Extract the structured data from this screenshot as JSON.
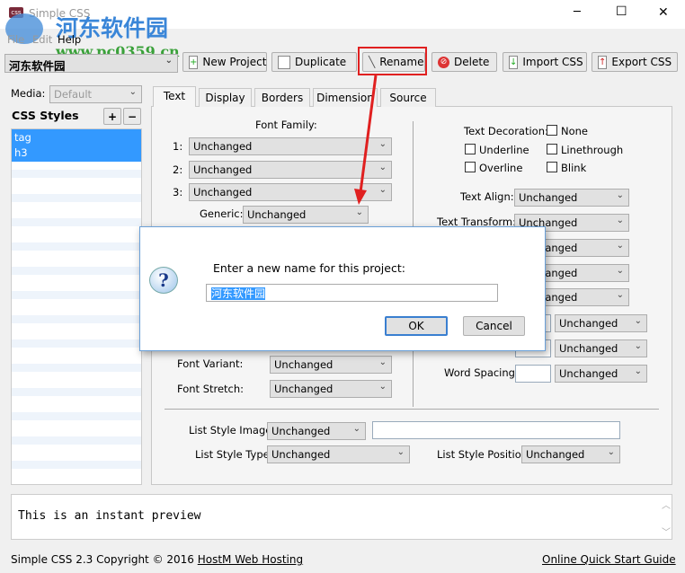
{
  "window": {
    "title": "Simple CSS",
    "minimize": "─",
    "maximize": "☐",
    "close": "✕"
  },
  "watermark": {
    "name": "河东软件园",
    "url": "www.pc0359.cn"
  },
  "menu": [
    "File",
    "Edit",
    "Help"
  ],
  "toolbar": {
    "project": "河东软件园",
    "new_project": "New Project",
    "duplicate": "Duplicate",
    "rename": "Rename",
    "delete": "Delete",
    "import": "Import CSS",
    "export": "Export CSS"
  },
  "sidebar": {
    "media_label": "Media:",
    "media_value": "Default",
    "styles_label": "CSS Styles",
    "add": "+",
    "remove": "−",
    "items": [
      "tag",
      "h3"
    ]
  },
  "tabs": [
    "Text",
    "Display",
    "Borders",
    "Dimension",
    "Source"
  ],
  "text_tab": {
    "font_family": "Font Family:",
    "row_labels": [
      "1:",
      "2:",
      "3:"
    ],
    "generic": "Generic:",
    "unchanged": "Unchanged",
    "font_variant": "Font Variant:",
    "font_stretch": "Font Stretch:",
    "text_decoration": "Text Decoration:",
    "none": "None",
    "underline": "Underline",
    "linethrough": "Linethrough",
    "overline": "Overline",
    "blink": "Blink",
    "text_align": "Text Align:",
    "text_transform": "Text Transform:",
    "word_spacing": "Word Spacing:",
    "list_style_image": "List Style Image:",
    "list_style_type": "List Style Type:",
    "list_style_position": "List Style Position:"
  },
  "preview": "This is an instant preview",
  "status": {
    "copyright": "Simple CSS 2.3 Copyright © 2016 ",
    "host_link": "HostM Web Hosting",
    "guide_link": "Online Quick Start Guide"
  },
  "dialog": {
    "prompt": "Enter a new name for this project:",
    "value": "河东软件园",
    "ok": "OK",
    "cancel": "Cancel"
  },
  "colors": {
    "selection": "#3399ff",
    "highlight": "#e02020"
  }
}
